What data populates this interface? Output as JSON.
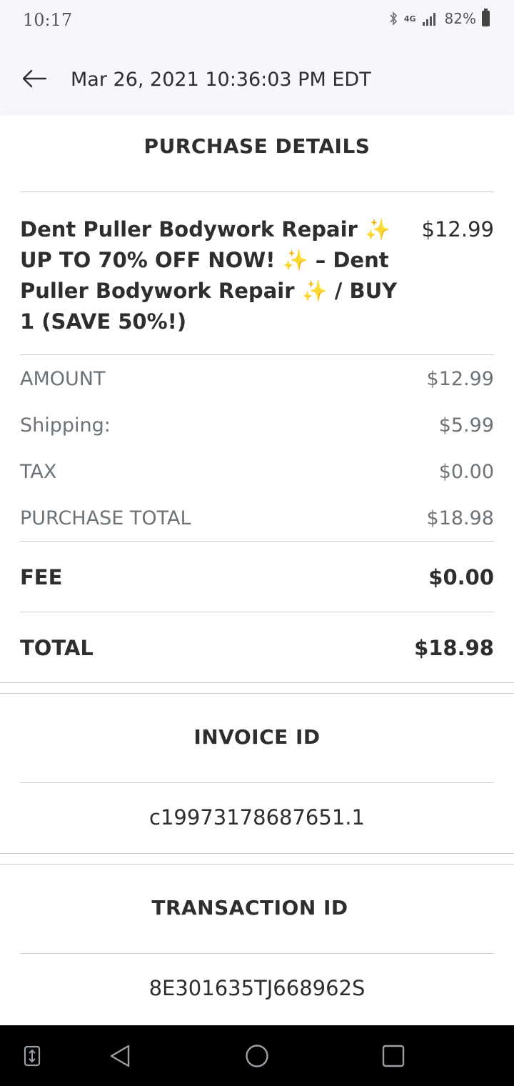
{
  "status_bar": {
    "time": "10:17",
    "network": "4G",
    "battery": "82%"
  },
  "header": {
    "title": "Mar 26, 2021 10:36:03 PM EDT"
  },
  "purchase_details": {
    "title": "PURCHASE DETAILS",
    "item": {
      "name": "Dent Puller Bodywork Repair ✨ UP TO 70% OFF NOW! ✨ – Dent Puller Bodywork Repair ✨ / BUY 1 (SAVE 50%!)",
      "price": "$12.99"
    },
    "rows": [
      {
        "label": "AMOUNT",
        "value": "$12.99"
      },
      {
        "label": "Shipping:",
        "value": "$5.99"
      },
      {
        "label": "TAX",
        "value": "$0.00"
      },
      {
        "label": "PURCHASE TOTAL",
        "value": "$18.98"
      }
    ],
    "fee": {
      "label": "FEE",
      "value": "$0.00"
    },
    "total": {
      "label": "TOTAL",
      "value": "$18.98"
    }
  },
  "invoice": {
    "title": "INVOICE ID",
    "value": "c19973178687651.1"
  },
  "transaction": {
    "title": "TRANSACTION ID",
    "value": "8E301635TJ668962S"
  },
  "colors": {
    "text_primary": "#2c2e2f",
    "text_secondary": "#6c7378",
    "divider": "#c9cdd1",
    "header_bg": "#f5f7fa"
  },
  "icons": [
    "back-arrow-icon",
    "bluetooth-icon",
    "signal-icon",
    "battery-icon",
    "switch-apps-icon",
    "nav-back-icon",
    "nav-home-icon",
    "nav-recents-icon"
  ]
}
